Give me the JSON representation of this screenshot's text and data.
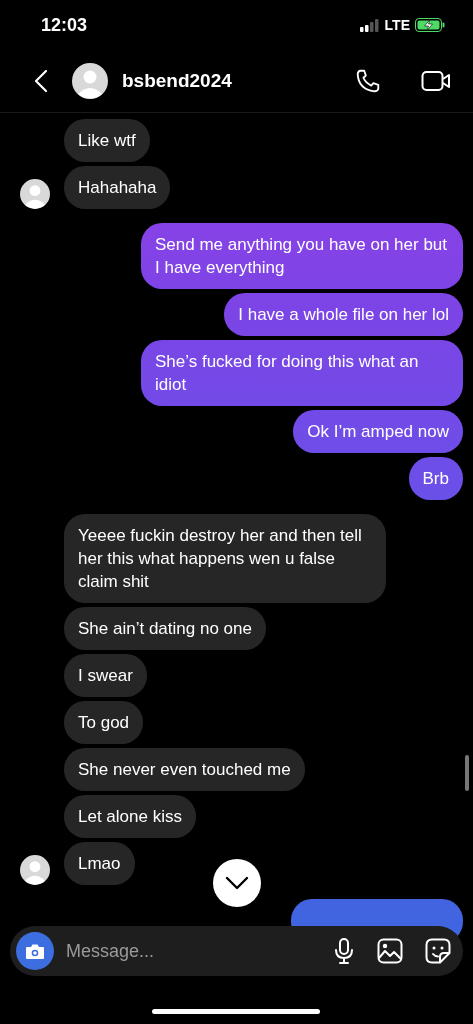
{
  "status_bar": {
    "time": "12:03",
    "network": "LTE"
  },
  "header": {
    "username": "bsbend2024"
  },
  "messages": [
    {
      "kind": "received",
      "text": "Like wtf",
      "avatar": false
    },
    {
      "kind": "received",
      "text": "Hahahaha",
      "avatar": true
    },
    {
      "kind": "sent",
      "text": "Send me anything you have on her but I have everything"
    },
    {
      "kind": "sent",
      "text": "I have a whole file on her lol"
    },
    {
      "kind": "sent",
      "text": "She’s fucked for doing this what an idiot"
    },
    {
      "kind": "sent",
      "text": "Ok I’m amped now"
    },
    {
      "kind": "sent",
      "text": "Brb"
    },
    {
      "kind": "received",
      "text": "Yeeee fuckin destroy her and then tell her this what happens wen u false claim shit",
      "avatar": false
    },
    {
      "kind": "received",
      "text": "She ain’t dating no one",
      "avatar": false
    },
    {
      "kind": "received",
      "text": "I swear",
      "avatar": false
    },
    {
      "kind": "received",
      "text": "To god",
      "avatar": false
    },
    {
      "kind": "received",
      "text": "She never even touched me",
      "avatar": false
    },
    {
      "kind": "received",
      "text": "Let alone kiss",
      "avatar": false
    },
    {
      "kind": "received",
      "text": "Lmao",
      "avatar": true
    },
    {
      "kind": "sent_hidden"
    }
  ],
  "composer": {
    "placeholder": "Message..."
  }
}
